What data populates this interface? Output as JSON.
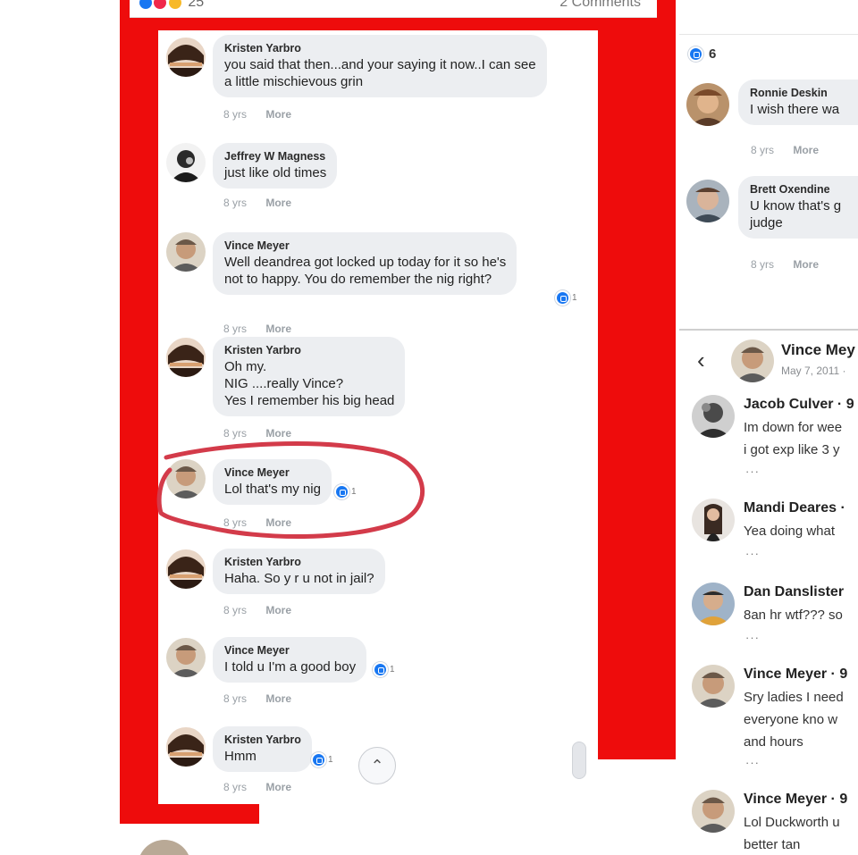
{
  "colors": {
    "frame_red": "#ee0c0c",
    "bubble_gray": "#eceef1",
    "like_blue": "#1877f2",
    "marker_red": "#d33b4a",
    "marker_orange": "#e8692a"
  },
  "top_strip": {
    "reaction_count": "25",
    "comments_label": "2 Comments"
  },
  "left_comments": [
    {
      "author": "Kristen Yarbro",
      "text": "you said that then...and your saying it now..I can see\na little mischievous grin",
      "time": "8 yrs",
      "more": "More",
      "reactions": ""
    },
    {
      "author": "Jeffrey W Magness",
      "text": "just like old times",
      "time": "8 yrs",
      "more": "More",
      "reactions": ""
    },
    {
      "author": "Vince Meyer",
      "text": "Well deandrea got locked up today for it so he's\nnot to happy. You do remember the nig right?",
      "time": "8 yrs",
      "more": "More",
      "reactions": "1"
    },
    {
      "author": "Kristen Yarbro",
      "text": "Oh my.\nNIG ....really Vince?\nYes I remember his big head",
      "time": "8 yrs",
      "more": "More",
      "reactions": ""
    },
    {
      "author": "Vince Meyer",
      "text": "Lol that's my nig",
      "time": "8 yrs",
      "more": "More",
      "reactions": "1"
    },
    {
      "author": "Kristen Yarbro",
      "text": "Haha. So y r u not in jail?",
      "time": "8 yrs",
      "more": "More",
      "reactions": ""
    },
    {
      "author": "Vince Meyer",
      "text": "I told u I'm a good boy",
      "time": "8 yrs",
      "more": "More",
      "reactions": "1"
    },
    {
      "author": "Kristen Yarbro",
      "text": "Hmm",
      "time": "8 yrs",
      "more": "More",
      "reactions": "1"
    }
  ],
  "right_top": {
    "reaction_count": "6",
    "comments": [
      {
        "author": "Ronnie Deskin",
        "text": "I wish there wa",
        "time": "8 yrs",
        "more": "More"
      },
      {
        "author": "Brett Oxendine",
        "text": "U know that's g\njudge",
        "time": "8 yrs",
        "more": "More"
      }
    ]
  },
  "right_bottom": {
    "header_name": "Vince Mey",
    "header_date": "May 7, 2011 ·",
    "comments": [
      {
        "author": "Jacob Culver · 9",
        "text": "Im down for wee\ni got exp like 3 y",
        "dots": "···"
      },
      {
        "author": "Mandi Deares ·",
        "text": "Yea doing what",
        "dots": "···"
      },
      {
        "author": "Dan Danslister",
        "text": "8an hr wtf??? so",
        "dots": "···"
      },
      {
        "author": "Vince Meyer · 9",
        "text": "Sry ladies I need\neveryone kno w\nand hours",
        "dots": "···"
      },
      {
        "author": "Vince Meyer · 9",
        "text": "Lol Duckworth u\nbetter tan",
        "dots": ""
      }
    ]
  }
}
